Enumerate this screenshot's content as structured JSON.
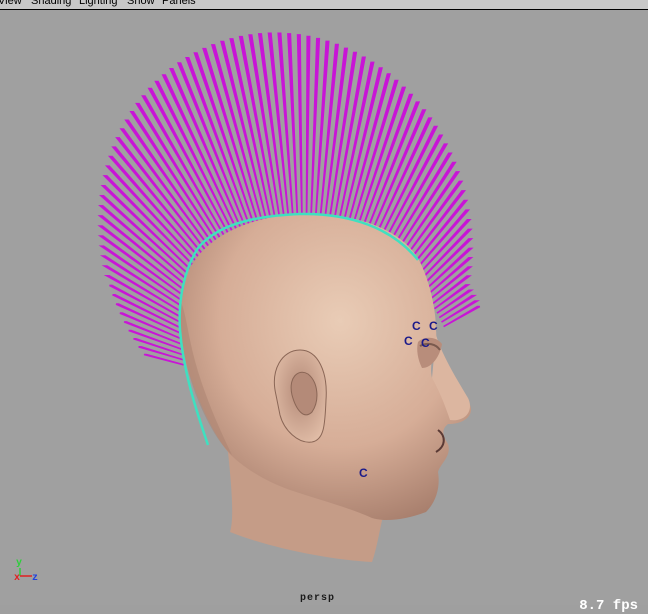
{
  "menu": [
    "View",
    "Shading",
    "Lighting",
    "Show",
    "Panels"
  ],
  "viewport": {
    "camera": "persp",
    "fps": "8.7 fps",
    "markers": [
      "C",
      "C",
      "C",
      "C",
      "C"
    ],
    "axes": {
      "y": "y",
      "x": "x",
      "z": "z"
    }
  },
  "colors": {
    "hair": "#c815d6",
    "scalp_curve": "#3fe0c0",
    "background": "#a0a0a0"
  }
}
